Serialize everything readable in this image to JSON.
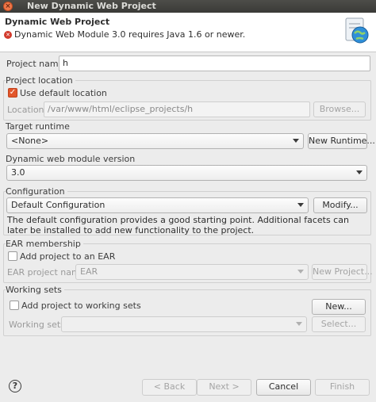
{
  "window": {
    "title": "New Dynamic Web Project"
  },
  "banner": {
    "title": "Dynamic Web Project",
    "message": "Dynamic Web Module 3.0 requires Java 1.6 or newer."
  },
  "project_name": {
    "label": "Project name:",
    "value": "h"
  },
  "project_location": {
    "group_label": "Project location",
    "use_default_label": "Use default location",
    "use_default_checked": true,
    "location_label": "Location:",
    "location_value": "/var/www/html/eclipse_projects/h",
    "browse_label": "Browse..."
  },
  "target_runtime": {
    "group_label": "Target runtime",
    "value": "<None>",
    "new_runtime_label": "New Runtime..."
  },
  "module_version": {
    "group_label": "Dynamic web module version",
    "value": "3.0"
  },
  "configuration": {
    "group_label": "Configuration",
    "value": "Default Configuration",
    "modify_label": "Modify...",
    "description": "The default configuration provides a good starting point. Additional facets can later be installed to add new functionality to the project."
  },
  "ear_membership": {
    "group_label": "EAR membership",
    "add_label": "Add project to an EAR",
    "add_checked": false,
    "ear_name_label": "EAR project name:",
    "ear_name_value": "EAR",
    "new_project_label": "New Project..."
  },
  "working_sets": {
    "group_label": "Working sets",
    "add_label": "Add project to working sets",
    "add_checked": false,
    "new_label": "New...",
    "sets_label": "Working sets:",
    "sets_value": "",
    "select_label": "Select..."
  },
  "footer": {
    "help_glyph": "?",
    "back_label": "< Back",
    "next_label": "Next >",
    "cancel_label": "Cancel",
    "finish_label": "Finish"
  },
  "icons": {
    "close": "close-icon",
    "error": "error-icon",
    "help": "help-icon",
    "banner": "web-project-globe-icon"
  },
  "colors": {
    "accent_checkbox": "#e2562b",
    "error": "#d23a2c",
    "titlebar": "#3a3a37"
  }
}
